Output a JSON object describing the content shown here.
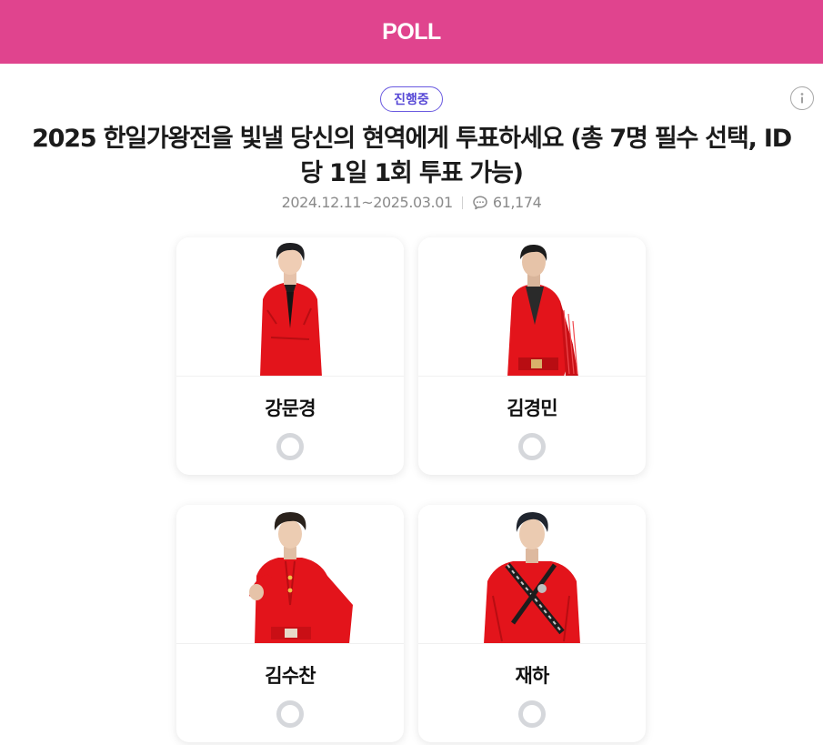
{
  "header": {
    "title": "POLL"
  },
  "info": {
    "icon": "info-icon"
  },
  "poll": {
    "status": "진행중",
    "title": "2025 한일가왕전을 빛낼 당신의 현역에게 투표하세요 (총 7명 필수 선택, ID 당 1일 1회 투표 가능)",
    "period": "2024.12.11~2025.03.01",
    "comment_icon": "comment-icon",
    "comment_count": "61,174"
  },
  "candidates": [
    {
      "name": "강문경",
      "selected": false
    },
    {
      "name": "김경민",
      "selected": false
    },
    {
      "name": "김수찬",
      "selected": false
    },
    {
      "name": "재하",
      "selected": false
    }
  ],
  "colors": {
    "header_bg": "#e0448e",
    "badge": "#5748d6",
    "costume_red": "#e3141b",
    "radio_ring": "#d5d7db"
  }
}
